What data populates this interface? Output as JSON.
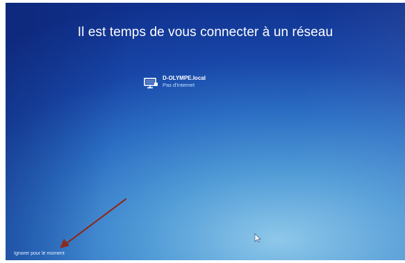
{
  "screen": {
    "title": "Il est temps de vous connecter à un réseau",
    "networks": [
      {
        "name": "D-OLYMPE.local",
        "status": "Pas d'Internet",
        "icon": "ethernet-computer-icon"
      }
    ],
    "skip_label": "Ignorer pour le moment"
  },
  "colors": {
    "background_dark": "#10318e",
    "background_light": "#8ec8ea",
    "status_text": "#bfe4ff",
    "annotation_arrow": "#8b2a1e"
  }
}
